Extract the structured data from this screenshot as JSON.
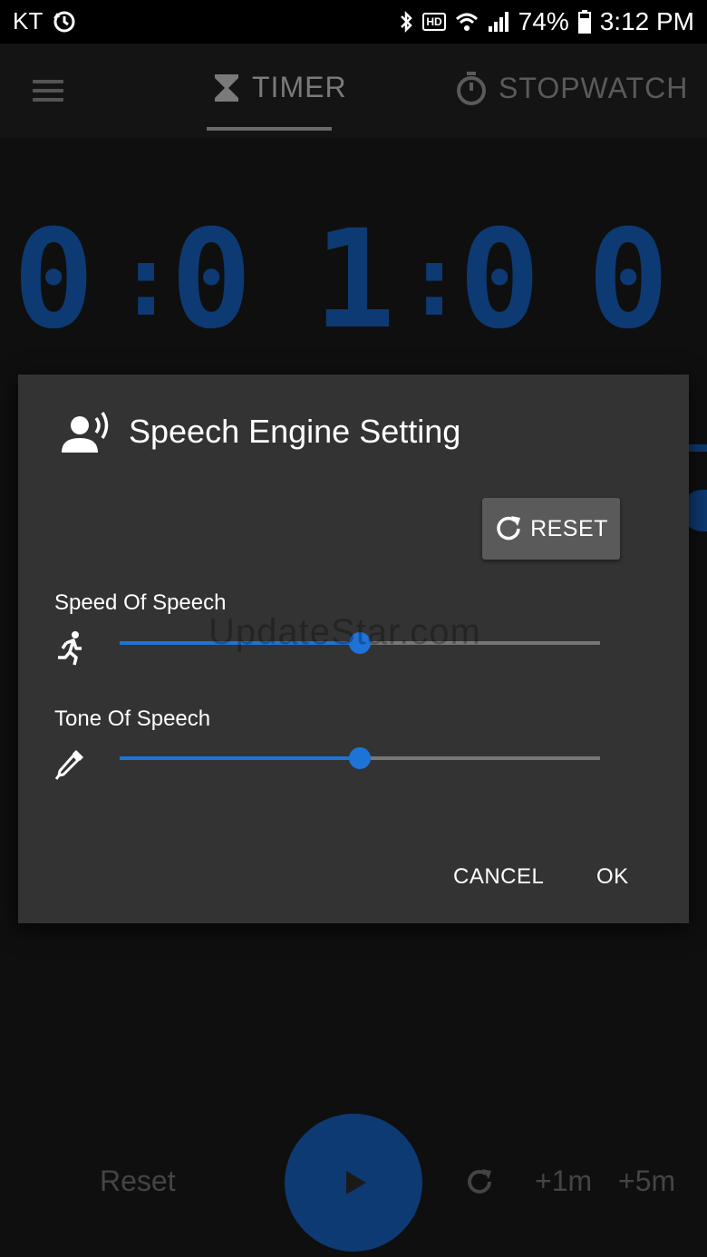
{
  "status_bar": {
    "carrier": "KT",
    "battery": "74%",
    "time": "3:12 PM",
    "hd": "HD"
  },
  "app": {
    "tabs": [
      {
        "label": "TIMER",
        "active": true
      },
      {
        "label": "STOPWATCH",
        "active": false
      }
    ],
    "timer_display": [
      "0",
      ":",
      "0",
      "1",
      ":",
      "0",
      "0"
    ],
    "accent_color": "#0d3a72",
    "controls": {
      "reset_label": "Reset",
      "plus1_label": "+1m",
      "plus5_label": "+5m"
    }
  },
  "dialog": {
    "title": "Speech Engine Setting",
    "reset_button_label": "RESET",
    "sliders": [
      {
        "label": "Speed Of Speech",
        "value": 0.5,
        "icon": "running-person-icon"
      },
      {
        "label": "Tone Of Speech",
        "value": 0.5,
        "icon": "eyedropper-icon"
      }
    ],
    "slider_color": "#1e74d6",
    "cancel_label": "CANCEL",
    "ok_label": "OK",
    "watermark": "UpdateStar.com"
  }
}
